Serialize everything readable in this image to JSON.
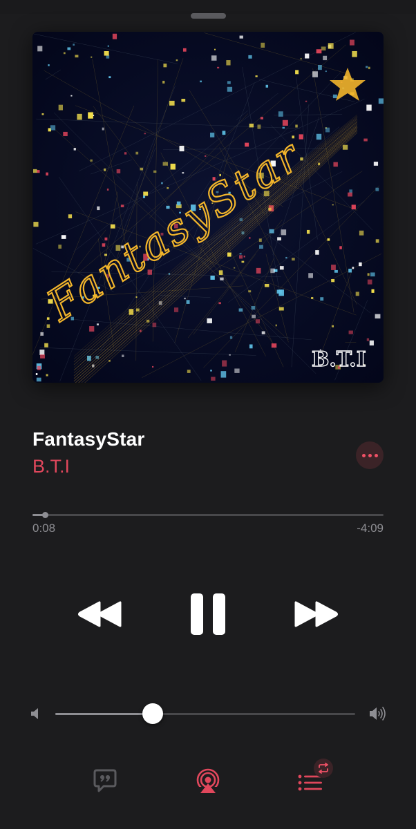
{
  "sheet": {
    "grabber": "sheet-grabber"
  },
  "artwork": {
    "title_text": "FantasyStar",
    "artist_text": "B.T.I",
    "background": "#050a1e",
    "title_glow": "#f2b52b"
  },
  "track": {
    "title": "FantasyStar",
    "artist": "B.T.I"
  },
  "progress": {
    "elapsed": "0:08",
    "remaining": "-4:09",
    "fraction": 0.035
  },
  "controls": {
    "rewind_icon": "rewind-icon",
    "pause_icon": "pause-icon",
    "forward_icon": "fast-forward-icon"
  },
  "volume": {
    "level": 0.325,
    "low_icon": "speaker-low-icon",
    "high_icon": "speaker-high-icon"
  },
  "bottom_bar": {
    "lyrics_icon": "lyrics-quote-bubble-icon",
    "airplay_icon": "airplay-audio-icon",
    "queue_icon": "up-next-list-icon",
    "repeat_badge_icon": "repeat-icon"
  },
  "colors": {
    "accent": "#e0475c",
    "background": "#1c1c1e",
    "muted": "#8e8e93",
    "track": "#48484b"
  }
}
